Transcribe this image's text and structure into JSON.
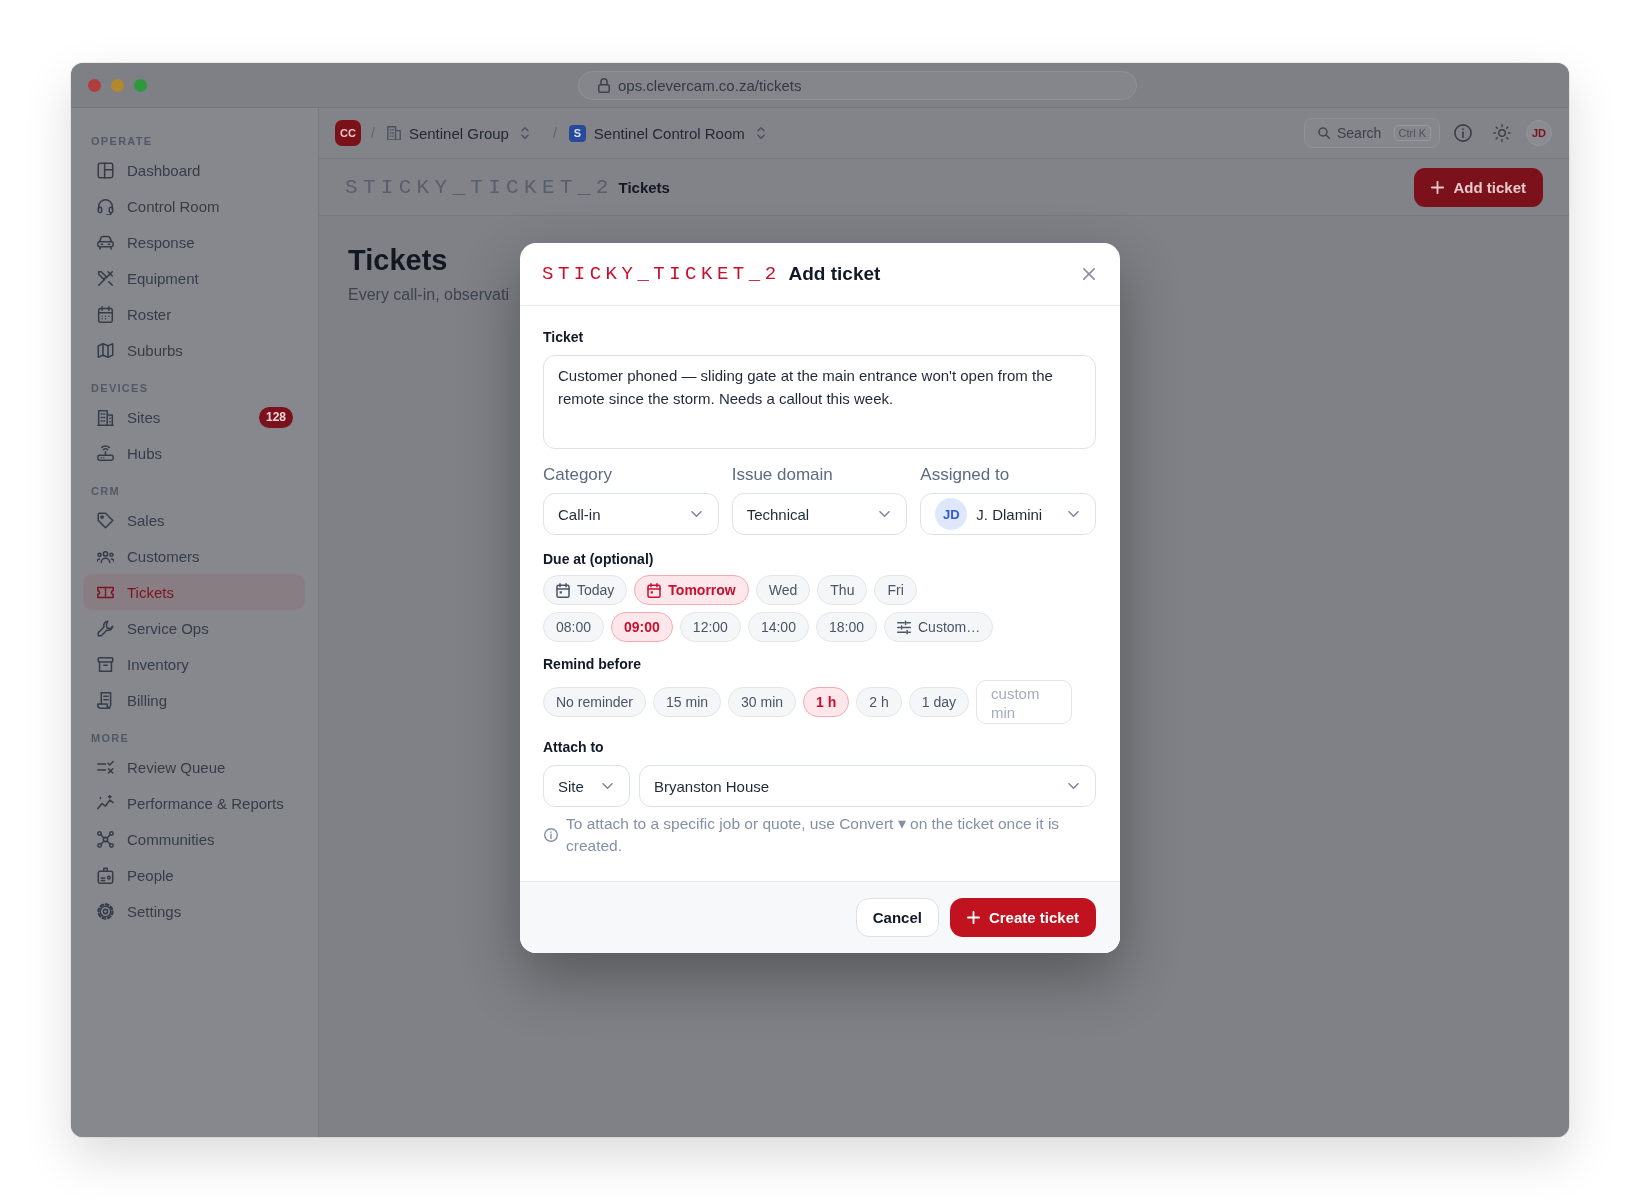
{
  "window": {
    "url": "ops.clevercam.co.za/tickets"
  },
  "sidebar": {
    "sections": [
      {
        "title": "OPERATE",
        "items": [
          {
            "label": "Dashboard",
            "selected": false
          },
          {
            "label": "Control Room",
            "selected": false
          },
          {
            "label": "Response",
            "selected": false
          },
          {
            "label": "Equipment",
            "selected": false
          },
          {
            "label": "Roster",
            "selected": false
          },
          {
            "label": "Suburbs",
            "selected": false
          }
        ]
      },
      {
        "title": "DEVICES",
        "items": [
          {
            "label": "Sites",
            "selected": false,
            "badge": "128"
          },
          {
            "label": "Hubs",
            "selected": false
          }
        ]
      },
      {
        "title": "CRM",
        "items": [
          {
            "label": "Sales",
            "selected": false
          },
          {
            "label": "Customers",
            "selected": false
          },
          {
            "label": "Tickets",
            "selected": true
          },
          {
            "label": "Service Ops",
            "selected": false
          },
          {
            "label": "Inventory",
            "selected": false
          },
          {
            "label": "Billing",
            "selected": false
          }
        ]
      },
      {
        "title": "MORE",
        "items": [
          {
            "label": "Review Queue",
            "selected": false
          },
          {
            "label": "Performance & Reports",
            "selected": false
          },
          {
            "label": "Communities",
            "selected": false
          },
          {
            "label": "People",
            "selected": false
          },
          {
            "label": "Settings",
            "selected": false
          }
        ]
      }
    ]
  },
  "topbar": {
    "org_badge": "CC",
    "breadcrumbs": [
      {
        "separator": "/",
        "label": "Sentinel Group"
      },
      {
        "separator": "/",
        "badge": "S",
        "label": "Sentinel Control Room"
      }
    ],
    "search": {
      "label": "Search",
      "shortcut": "Ctrl K"
    },
    "user_avatar": "JD"
  },
  "page_header": {
    "marker": "STICKY_TICKET_2",
    "title": "Tickets",
    "add_button": "Add ticket"
  },
  "page": {
    "title": "Tickets",
    "subtitle": "Every call-in, observati"
  },
  "modal": {
    "marker": "STICKY_TICKET_2",
    "title": "Add ticket",
    "ticket": {
      "label": "Ticket",
      "value": "Customer phoned — sliding gate at the main entrance won't open from the remote since the storm. Needs a callout this week."
    },
    "selects": [
      {
        "label": "Category",
        "value": "Call-in"
      },
      {
        "label": "Issue domain",
        "value": "Technical"
      },
      {
        "label": "Assigned to",
        "value": "J. Dlamini",
        "avatar": "JD"
      }
    ],
    "due": {
      "label": "Due at (optional)",
      "days": [
        {
          "label": "Today",
          "selected": false,
          "kind": "calendar"
        },
        {
          "label": "Tomorrow",
          "selected": true,
          "kind": "calendar"
        },
        {
          "label": "Wed",
          "selected": false,
          "kind": "day"
        },
        {
          "label": "Thu",
          "selected": false,
          "kind": "day"
        },
        {
          "label": "Fri",
          "selected": false,
          "kind": "day"
        }
      ],
      "times": [
        {
          "label": "08:00",
          "selected": false,
          "kind": "time"
        },
        {
          "label": "09:00",
          "selected": true,
          "kind": "time"
        },
        {
          "label": "12:00",
          "selected": false,
          "kind": "time"
        },
        {
          "label": "14:00",
          "selected": false,
          "kind": "time"
        },
        {
          "label": "18:00",
          "selected": false,
          "kind": "time"
        },
        {
          "label": "Custom…",
          "selected": false,
          "kind": "custom"
        }
      ]
    },
    "remind": {
      "label": "Remind before",
      "options": [
        {
          "label": "No reminder",
          "selected": false
        },
        {
          "label": "15 min",
          "selected": false
        },
        {
          "label": "30 min",
          "selected": false
        },
        {
          "label": "1 h",
          "selected": true
        },
        {
          "label": "2 h",
          "selected": false
        },
        {
          "label": "1 day",
          "selected": false
        }
      ],
      "custom": {
        "placeholder": "custom min"
      }
    },
    "attach": {
      "label": "Attach to",
      "type": {
        "value": "Site"
      },
      "target": {
        "value": "Bryanston House"
      },
      "note": "To attach to a specific job or quote, use Convert ▾ on the ticket once it is created."
    },
    "footer": {
      "cancel": "Cancel",
      "create": "Create ticket"
    }
  }
}
